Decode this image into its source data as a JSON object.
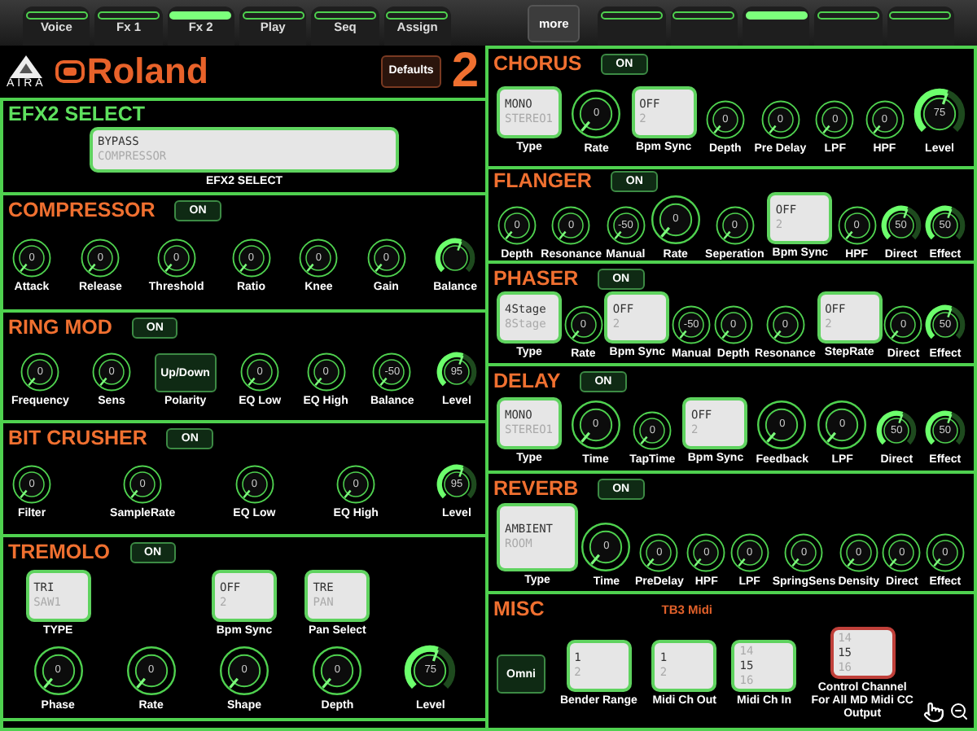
{
  "tabs_left": [
    {
      "label": "Voice",
      "selected": false
    },
    {
      "label": "Fx 1",
      "selected": false
    },
    {
      "label": "Fx 2",
      "selected": true
    },
    {
      "label": "Play",
      "selected": false
    },
    {
      "label": "Seq",
      "selected": false
    },
    {
      "label": "Assign",
      "selected": false
    }
  ],
  "more_button": "more",
  "tabs_right": [
    {
      "selected": false
    },
    {
      "selected": false
    },
    {
      "selected": true
    },
    {
      "selected": false
    },
    {
      "selected": false
    }
  ],
  "header": {
    "brand": "AIRA",
    "logo": "Roland",
    "defaults_button": "Defaults",
    "fx_number": "2"
  },
  "left_sections": [
    {
      "title": "EFX2 SELECT",
      "color": "#5ee05e",
      "rows": [
        [
          {
            "kind": "wide_picker",
            "options": [
              {
                "text": "BYPASS",
                "selected": true
              },
              {
                "text": "COMPRESSOR",
                "selected": false
              }
            ],
            "label": "EFX2 SELECT",
            "focused": false
          }
        ]
      ]
    },
    {
      "title": "COMPRESSOR",
      "color": "#f07030",
      "button": "ON",
      "rows": [
        [
          {
            "kind": "knob",
            "value": "0",
            "label": "Attack"
          },
          {
            "kind": "knob",
            "value": "0",
            "label": "Release"
          },
          {
            "kind": "knob",
            "value": "0",
            "label": "Threshold"
          },
          {
            "kind": "knob",
            "value": "0",
            "label": "Ratio"
          },
          {
            "kind": "knob",
            "value": "0",
            "label": "Knee"
          },
          {
            "kind": "knob",
            "value": "0",
            "label": "Gain"
          },
          {
            "kind": "arc_knob",
            "label": "Balance"
          }
        ]
      ]
    },
    {
      "title": "RING MOD",
      "color": "#f07030",
      "button": "ON",
      "rows": [
        [
          {
            "kind": "knob",
            "value": "0",
            "label": "Frequency"
          },
          {
            "kind": "knob",
            "value": "0",
            "label": "Sens"
          },
          {
            "kind": "button",
            "text": "Up/Down",
            "label": "Polarity"
          },
          {
            "kind": "knob",
            "value": "0",
            "label": "EQ Low"
          },
          {
            "kind": "knob",
            "value": "0",
            "label": "EQ High"
          },
          {
            "kind": "knob",
            "value": "-50",
            "label": "Balance"
          },
          {
            "kind": "arc_knob",
            "value": "95",
            "label": "Level"
          }
        ]
      ]
    },
    {
      "title": "BIT CRUSHER",
      "color": "#f07030",
      "button": "ON",
      "rows": [
        [
          {
            "kind": "knob",
            "value": "0",
            "label": "Filter"
          },
          {
            "kind": "knob",
            "value": "0",
            "label": "SampleRate"
          },
          {
            "kind": "knob",
            "value": "0",
            "label": "EQ Low"
          },
          {
            "kind": "knob",
            "value": "0",
            "label": "EQ High"
          },
          {
            "kind": "arc_knob",
            "value": "95",
            "label": "Level"
          }
        ]
      ]
    },
    {
      "title": "TREMOLO",
      "color": "#f07030",
      "button": "ON",
      "rows": [
        [
          {
            "kind": "picker",
            "options": [
              {
                "text": "TRI",
                "selected": true
              },
              {
                "text": "SAW1",
                "selected": false
              }
            ],
            "label": "TYPE",
            "focused": false
          },
          "",
          {
            "kind": "picker",
            "options": [
              {
                "text": "OFF",
                "selected": true
              },
              {
                "text": "2",
                "selected": false
              }
            ],
            "label": "Bpm Sync",
            "focused": false
          },
          {
            "kind": "picker",
            "options": [
              {
                "text": "TRE",
                "selected": true
              },
              {
                "text": "PAN",
                "selected": false
              }
            ],
            "label": "Pan Select",
            "focused": false
          },
          ""
        ],
        [
          {
            "kind": "large_knob",
            "value": "0",
            "label": "Phase"
          },
          {
            "kind": "large_knob",
            "value": "0",
            "label": "Rate"
          },
          {
            "kind": "large_knob",
            "value": "0",
            "label": "Shape"
          },
          {
            "kind": "large_knob",
            "value": "0",
            "label": "Depth"
          },
          {
            "kind": "large_arc_knob",
            "value": "75",
            "label": "Level"
          }
        ]
      ]
    }
  ],
  "right_sections": [
    {
      "title": "CHORUS",
      "color": "#f07030",
      "button": "ON",
      "rows": [
        [
          {
            "kind": "picker",
            "options": [
              {
                "text": "MONO",
                "selected": true
              },
              {
                "text": "STEREO1",
                "selected": false
              }
            ],
            "label": "Type",
            "focused": false
          },
          {
            "kind": "large_knob",
            "value": "0",
            "label": "Rate"
          },
          {
            "kind": "picker",
            "options": [
              {
                "text": "OFF",
                "selected": true
              },
              {
                "text": "2",
                "selected": false
              }
            ],
            "label": "Bpm Sync",
            "focused": false
          },
          {
            "kind": "knob",
            "value": "0",
            "label": "Depth"
          },
          {
            "kind": "knob",
            "value": "0",
            "label": "Pre Delay"
          },
          {
            "kind": "knob",
            "value": "0",
            "label": "LPF"
          },
          {
            "kind": "knob",
            "value": "0",
            "label": "HPF"
          },
          {
            "kind": "large_arc_knob",
            "value": "75",
            "label": "Level"
          }
        ]
      ]
    },
    {
      "title": "FLANGER",
      "color": "#f07030",
      "button": "ON",
      "rows": [
        [
          {
            "kind": "knob",
            "value": "0",
            "label": "Depth"
          },
          {
            "kind": "knob",
            "value": "0",
            "label": "Resonance"
          },
          {
            "kind": "knob",
            "value": "-50",
            "label": "Manual"
          },
          {
            "kind": "large_knob",
            "value": "0",
            "label": "Rate"
          },
          {
            "kind": "knob",
            "value": "0",
            "label": "Seperation"
          },
          {
            "kind": "picker",
            "options": [
              {
                "text": "OFF",
                "selected": true
              },
              {
                "text": "2",
                "selected": false
              }
            ],
            "label": "Bpm Sync",
            "focused": false
          },
          {
            "kind": "knob",
            "value": "0",
            "label": "HPF"
          },
          {
            "kind": "arc_knob",
            "value": "50",
            "label": "Direct"
          },
          {
            "kind": "arc_knob",
            "value": "50",
            "label": "Effect"
          }
        ]
      ]
    },
    {
      "title": "PHASER",
      "color": "#f07030",
      "button": "ON",
      "rows": [
        [
          {
            "kind": "picker",
            "options": [
              {
                "text": "4Stage",
                "selected": true
              },
              {
                "text": "8Stage",
                "selected": false
              }
            ],
            "label": "Type",
            "focused": false
          },
          {
            "kind": "knob",
            "value": "0",
            "label": "Rate"
          },
          {
            "kind": "picker",
            "options": [
              {
                "text": "OFF",
                "selected": true
              },
              {
                "text": "2",
                "selected": false
              }
            ],
            "label": "Bpm Sync",
            "focused": false
          },
          {
            "kind": "knob",
            "value": "-50",
            "label": "Manual"
          },
          {
            "kind": "knob",
            "value": "0",
            "label": "Depth"
          },
          {
            "kind": "knob",
            "value": "0",
            "label": "Resonance"
          },
          {
            "kind": "picker",
            "options": [
              {
                "text": "OFF",
                "selected": true
              },
              {
                "text": "2",
                "selected": false
              }
            ],
            "label": "StepRate",
            "focused": false
          },
          {
            "kind": "knob",
            "value": "0",
            "label": "Direct"
          },
          {
            "kind": "arc_knob",
            "value": "50",
            "label": "Effect"
          }
        ]
      ]
    },
    {
      "title": "DELAY",
      "color": "#f07030",
      "button": "ON",
      "rows": [
        [
          {
            "kind": "picker",
            "options": [
              {
                "text": "MONO",
                "selected": true
              },
              {
                "text": "STEREO1",
                "selected": false
              }
            ],
            "label": "Type",
            "focused": false
          },
          {
            "kind": "large_knob",
            "value": "0",
            "label": "Time"
          },
          {
            "kind": "knob",
            "value": "0",
            "label": "TapTime"
          },
          {
            "kind": "picker",
            "options": [
              {
                "text": "OFF",
                "selected": true
              },
              {
                "text": "2",
                "selected": false
              }
            ],
            "label": "Bpm Sync",
            "focused": false
          },
          {
            "kind": "large_knob",
            "value": "0",
            "label": "Feedback"
          },
          {
            "kind": "large_knob",
            "value": "0",
            "label": "LPF"
          },
          {
            "kind": "arc_knob",
            "value": "50",
            "label": "Direct"
          },
          {
            "kind": "arc_knob",
            "value": "50",
            "label": "Effect"
          }
        ]
      ]
    },
    {
      "title": "REVERB",
      "color": "#f07030",
      "button": "ON",
      "rows": [
        [
          {
            "kind": "large_picker",
            "options": [
              {
                "text": "AMBIENT",
                "selected": true
              },
              {
                "text": "ROOM",
                "selected": false
              }
            ],
            "label": "Type",
            "focused": false
          },
          {
            "kind": "large_knob",
            "value": "0",
            "label": "Time"
          },
          {
            "kind": "knob",
            "value": "0",
            "label": "PreDelay"
          },
          {
            "kind": "knob",
            "value": "0",
            "label": "HPF"
          },
          {
            "kind": "knob",
            "value": "0",
            "label": "LPF"
          },
          {
            "kind": "knob",
            "value": "0",
            "label": "SpringSens"
          },
          {
            "kind": "knob",
            "value": "0",
            "label": "Density"
          },
          {
            "kind": "knob",
            "value": "0",
            "label": "Direct"
          },
          {
            "kind": "knob",
            "value": "0",
            "label": "Effect"
          }
        ]
      ]
    },
    {
      "title": "MISC",
      "color": "#f07030",
      "note": "TB3 Midi",
      "rows": [
        [
          {
            "kind": "button",
            "text": "Omni"
          },
          {
            "kind": "picker",
            "options": [
              {
                "text": "1",
                "selected": true
              },
              {
                "text": "2",
                "selected": false
              }
            ],
            "label": "Bender Range",
            "focused": false
          },
          {
            "kind": "picker",
            "options": [
              {
                "text": "1",
                "selected": true
              },
              {
                "text": "2",
                "selected": false
              }
            ],
            "label": "Midi Ch Out",
            "focused": false
          },
          {
            "kind": "picker",
            "options": [
              {
                "text": "14",
                "selected": false
              },
              {
                "text": "15",
                "selected": true
              },
              {
                "text": "16",
                "selected": false
              }
            ],
            "label": "Midi Ch In",
            "focused": false
          },
          {
            "kind": "picker",
            "options": [
              {
                "text": "14",
                "selected": false
              },
              {
                "text": "15",
                "selected": true
              },
              {
                "text": "16",
                "selected": false
              }
            ],
            "label": "Control Channel\nFor All MD Midi CC\nOutput",
            "focused": true
          }
        ]
      ]
    }
  ]
}
